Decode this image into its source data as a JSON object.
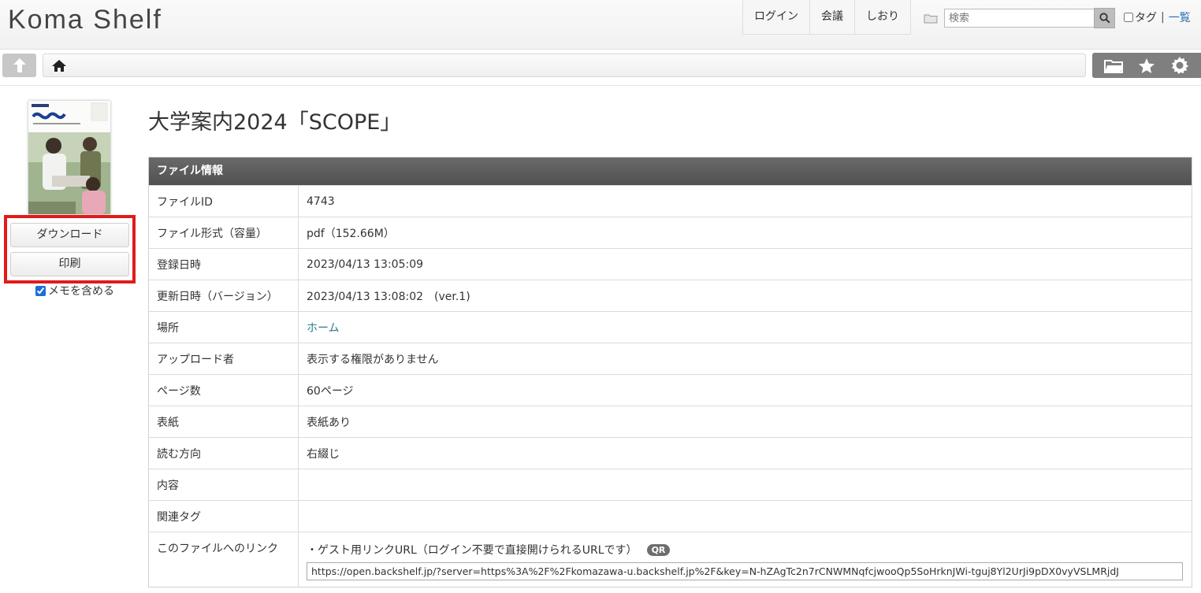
{
  "logo": "Koma Shelf",
  "nav": {
    "login": "ログイン",
    "meeting": "会議",
    "bookmark": "しおり"
  },
  "search": {
    "placeholder": "検索"
  },
  "tag": {
    "label": "タグ",
    "separator": "|",
    "list_link": "一覧",
    "checked": false
  },
  "sidebar": {
    "download_label": "ダウンロード",
    "print_label": "印刷",
    "memo_label": "メモを含める",
    "memo_checked": true
  },
  "page_title": "大学案内2024「SCOPE」",
  "file_info": {
    "header": "ファイル情報",
    "rows": [
      {
        "key": "ファイルID",
        "value": "4743"
      },
      {
        "key": "ファイル形式（容量）",
        "value": "pdf（152.66M）"
      },
      {
        "key": "登録日時",
        "value": "2023/04/13 13:05:09"
      },
      {
        "key": "更新日時（バージョン）",
        "value": "2023/04/13 13:08:02　(ver.1)"
      },
      {
        "key": "場所",
        "value": "ホーム"
      },
      {
        "key": "アップロード者",
        "value": "表示する権限がありません"
      },
      {
        "key": "ページ数",
        "value": "60ページ"
      },
      {
        "key": "表紙",
        "value": "表紙あり"
      },
      {
        "key": "読む方向",
        "value": "右綴じ"
      },
      {
        "key": "内容",
        "value": ""
      },
      {
        "key": "関連タグ",
        "value": ""
      },
      {
        "key": "このファイルへのリンク"
      }
    ],
    "guest_link_label": "・ゲスト用リンクURL（ログイン不要で直接開けられるURLです）",
    "qr_label": "QR",
    "guest_url": "https://open.backshelf.jp/?server=https%3A%2F%2Fkomazawa-u.backshelf.jp%2F&key=N-hZAgTc2n7rCNWMNqfcjwooQp5SoHrknJWi-tguj8Yl2UrJi9pDX0vyVSLMRjdJ"
  },
  "colors": {
    "highlight": "#e11a1a",
    "link": "#2a7c8f",
    "panel_header": "#5a5a5a"
  }
}
